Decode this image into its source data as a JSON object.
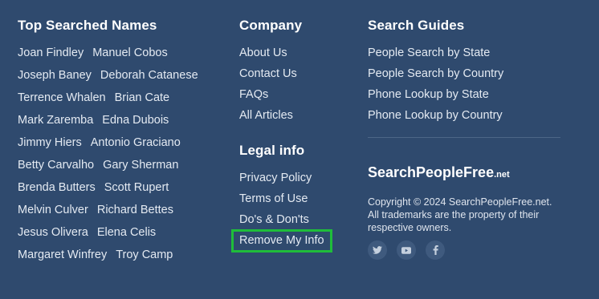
{
  "top_names": {
    "title": "Top Searched Names",
    "rows": [
      [
        "Joan Findley",
        "Manuel Cobos"
      ],
      [
        "Joseph Baney",
        "Deborah Catanese"
      ],
      [
        "Terrence Whalen",
        "Brian Cate"
      ],
      [
        "Mark Zaremba",
        "Edna Dubois"
      ],
      [
        "Jimmy Hiers",
        "Antonio Graciano"
      ],
      [
        "Betty Carvalho",
        "Gary Sherman"
      ],
      [
        "Brenda Butters",
        "Scott Rupert"
      ],
      [
        "Melvin Culver",
        "Richard Bettes"
      ],
      [
        "Jesus Olivera",
        "Elena Celis"
      ],
      [
        "Margaret Winfrey",
        "Troy Camp"
      ]
    ]
  },
  "company": {
    "title": "Company",
    "links": [
      "About Us",
      "Contact Us",
      "FAQs",
      "All Articles"
    ]
  },
  "legal": {
    "title": "Legal info",
    "links": [
      "Privacy Policy",
      "Terms of Use",
      "Do's & Don'ts"
    ],
    "highlighted_link": "Remove My Info"
  },
  "guides": {
    "title": "Search Guides",
    "links": [
      "People Search by State",
      "People Search by Country",
      "Phone Lookup by State",
      "Phone Lookup by Country"
    ]
  },
  "brand": {
    "name": "SearchPeopleFree",
    "suffix": ".net"
  },
  "copyright": "Copyright © 2024 SearchPeopleFree.net. All trademarks are the property of their respective owners.",
  "social_icons": [
    "twitter-icon",
    "youtube-icon",
    "facebook-icon"
  ],
  "colors": {
    "background": "#2f4a6e",
    "highlight_outline": "#1fbd3a"
  }
}
